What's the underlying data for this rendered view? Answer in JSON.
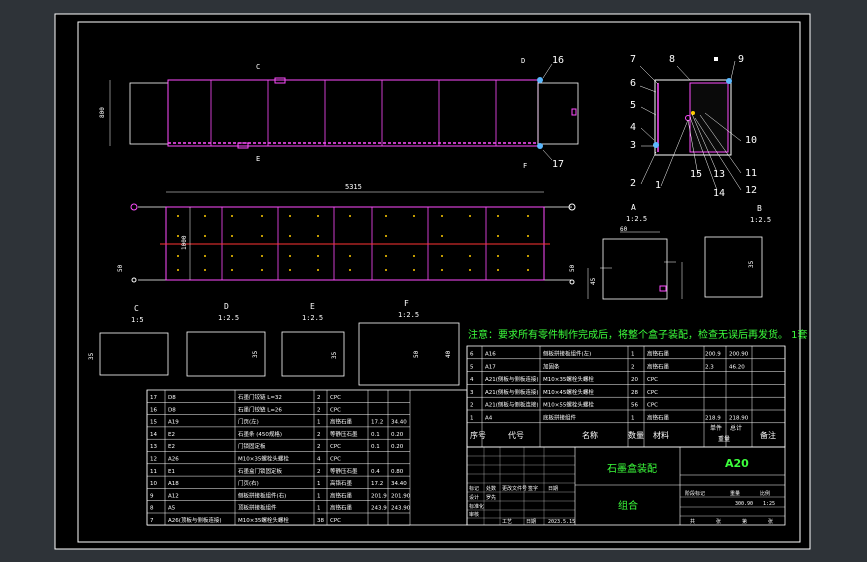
{
  "drawing": {
    "note": "注意：要求所有零件制作完成后，将整个盒子装配，检查无误后再发货。 1套",
    "title": "石墨盒装配",
    "drawing_no": "A20",
    "category": "组合",
    "scale": "1:25",
    "weight": "300.90",
    "main_dims": {
      "length": "5315",
      "height": "1000",
      "width_top": "800",
      "offset": "50"
    },
    "views": [
      {
        "id": "A",
        "scale": "1:2.5"
      },
      {
        "id": "B",
        "scale": "1:2.5"
      },
      {
        "id": "C",
        "scale": "1:5"
      },
      {
        "id": "D",
        "scale": "1:2.5"
      },
      {
        "id": "E",
        "scale": "1:2.5"
      },
      {
        "id": "F",
        "scale": "1:2.5"
      }
    ],
    "callouts": [
      "1",
      "2",
      "3",
      "4",
      "5",
      "6",
      "7",
      "8",
      "9",
      "10",
      "11",
      "12",
      "13",
      "14",
      "15",
      "16",
      "17"
    ],
    "view_markers": {
      "c": "C",
      "e": "E",
      "d": "D",
      "f": "F"
    },
    "section_dims": {
      "a1": "60",
      "a2": "45",
      "b1": "35",
      "c1": "35",
      "d1": "35",
      "e1": "35",
      "f1": "50",
      "f2": "40"
    }
  },
  "bom_right": {
    "headers": [
      "序号",
      "代号",
      "名称",
      "数量",
      "材料",
      "单件",
      "总计",
      "备注"
    ],
    "weight_header": "重量",
    "rows": [
      [
        "6",
        "A16",
        "侧板拼接板组件(左)",
        "1",
        "高铬石墨",
        "200.9",
        "200.90",
        ""
      ],
      [
        "5",
        "A17",
        "加固条",
        "2",
        "高铬石墨",
        "2.3",
        "46.20",
        ""
      ],
      [
        "4",
        "A21(侧板与侧板连接)",
        "M10×35螺栓头螺栓",
        "20",
        "CPC",
        "",
        "",
        ""
      ],
      [
        "3",
        "A21(侧板与侧板连接)",
        "M10×45螺栓头螺栓",
        "28",
        "CPC",
        "",
        "",
        ""
      ],
      [
        "2",
        "A21(侧板与侧板连接)",
        "M10×55螺栓头螺栓",
        "56",
        "CPC",
        "",
        "",
        ""
      ],
      [
        "1",
        "A4",
        "底板拼接组件",
        "1",
        "高铬石墨",
        "218.9",
        "218.90",
        ""
      ]
    ]
  },
  "bom_left": {
    "rows": [
      [
        "17",
        "D8",
        "石墨门铰链 L=32",
        "2",
        "CPC",
        "",
        ""
      ],
      [
        "16",
        "D8",
        "石墨门铰链 L=26",
        "2",
        "CPC",
        "",
        ""
      ],
      [
        "15",
        "A19",
        "门页(左)",
        "1",
        "高铬石墨",
        "17.2",
        "34.40"
      ],
      [
        "14",
        "E2",
        "石墨条 (450规格)",
        "2",
        "等静压石墨",
        "0.1",
        "0.20"
      ],
      [
        "13",
        "E2",
        "门锁固定板",
        "2",
        "CPC",
        "0.1",
        "0.20"
      ],
      [
        "12",
        "A26",
        "M10×35螺栓头螺栓",
        "4",
        "CPC",
        "",
        ""
      ],
      [
        "11",
        "E1",
        "石墨盒门锁固定板",
        "2",
        "等静压石墨",
        "0.4",
        "0.80"
      ],
      [
        "10",
        "A18",
        "门页(右)",
        "1",
        "高铬石墨",
        "17.2",
        "34.40"
      ],
      [
        "9",
        "A12",
        "侧板拼接板组件(右)",
        "1",
        "高铬石墨",
        "201.9",
        "201.90"
      ],
      [
        "8",
        "A5",
        "顶板拼接板组件",
        "1",
        "高铬石墨",
        "243.9",
        "243.90"
      ],
      [
        "7",
        "A26(顶板与侧板连接)",
        "M10×35螺栓头螺栓",
        "38",
        "CPC",
        "",
        ""
      ]
    ]
  },
  "title_block": {
    "labels": [
      "标记",
      "处数",
      "更改文件号",
      "签字",
      "日期"
    ],
    "roles": [
      "设计",
      "标准化",
      "审核",
      "工艺",
      "日期"
    ],
    "stage_labels": [
      "阶段标记",
      "重量",
      "比例"
    ],
    "sheet": [
      "共",
      "张",
      "第",
      "张"
    ],
    "designer": "罗先",
    "date": "2023.5.15"
  }
}
